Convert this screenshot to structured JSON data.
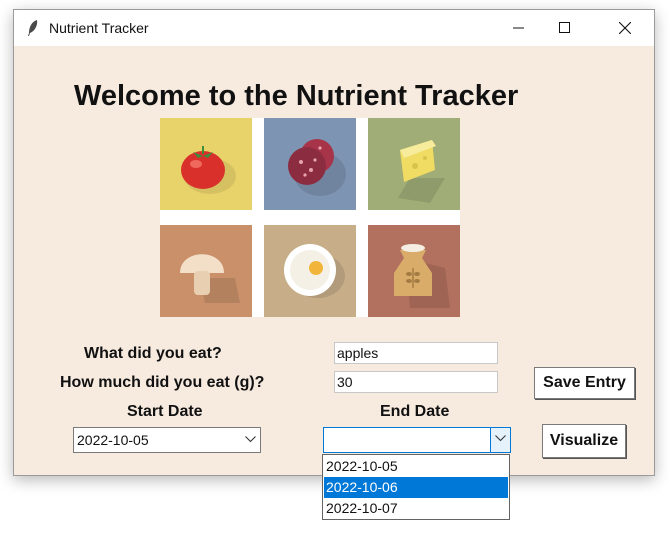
{
  "window": {
    "title": "Nutrient Tracker"
  },
  "main": {
    "heading": "Welcome to the Nutrient Tracker",
    "food_question_label": "What did you eat?",
    "food_value": "apples",
    "amount_question_label": "How much did you eat (g)?",
    "amount_value": "30",
    "save_button_label": "Save Entry",
    "start_date_label": "Start Date",
    "start_date_value": "2022-10-05",
    "end_date_label": "End Date",
    "end_date_value": "",
    "visualize_button_label": "Visualize"
  },
  "end_date_dropdown": {
    "options": [
      "2022-10-05",
      "2022-10-06",
      "2022-10-07"
    ],
    "selected": "2022-10-06"
  },
  "food_images": [
    {
      "icon": "tomato-icon",
      "bg": "#e8d26a"
    },
    {
      "icon": "salami-icon",
      "bg": "#7d94b2"
    },
    {
      "icon": "cheese-icon",
      "bg": "#a0ad76"
    },
    {
      "icon": "mushroom-icon",
      "bg": "#c9906a"
    },
    {
      "icon": "fried-egg-icon",
      "bg": "#c7ad88"
    },
    {
      "icon": "flour-sack-icon",
      "bg": "#b2705e"
    }
  ],
  "colors": {
    "window_bg": "#f7ebe0",
    "accent": "#0078d7"
  }
}
